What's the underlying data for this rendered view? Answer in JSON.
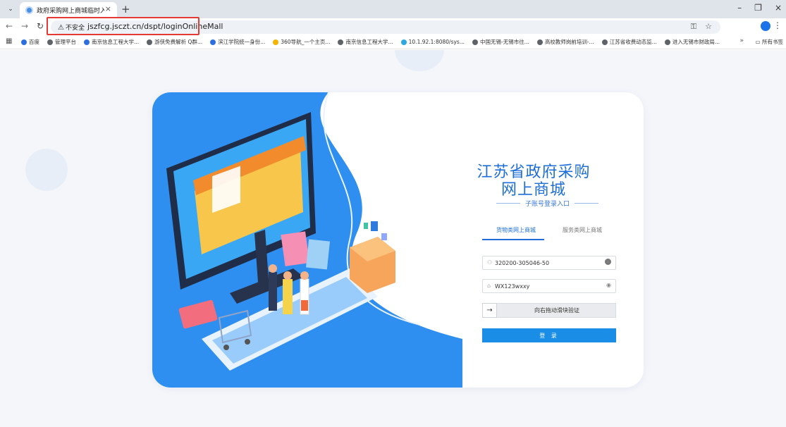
{
  "browser": {
    "tab_title": "政府采购网上商城临时入口",
    "security_label": "不安全",
    "url": "jszfcg.jsczt.cn/dspt/loginOnlineMall",
    "bookmarks": [
      {
        "label": "百度",
        "icon": "paw-icon",
        "color": "blue"
      },
      {
        "label": "管理平台",
        "icon": "globe-icon",
        "color": "dark"
      },
      {
        "label": "南京信息工程大学...",
        "icon": "paw-icon",
        "color": "blue"
      },
      {
        "label": "游侠免费解析 Q群...",
        "icon": "globe-icon",
        "color": "dark"
      },
      {
        "label": "滨江学院统一身份...",
        "icon": "shield-icon",
        "color": "blue"
      },
      {
        "label": "360导航_一个主页...",
        "icon": "nav-icon",
        "color": "yellow"
      },
      {
        "label": "南京信息工程大学...",
        "icon": "globe-icon",
        "color": "dark"
      },
      {
        "label": "10.1.92.1:8080/sys...",
        "icon": "globe-icon",
        "color": "cyan"
      },
      {
        "label": "中国无锡-无锡市往...",
        "icon": "globe-icon",
        "color": "dark"
      },
      {
        "label": "高校教师岗前培训-...",
        "icon": "globe-icon",
        "color": "dark"
      },
      {
        "label": "江苏省收费动态监...",
        "icon": "globe-icon",
        "color": "dark"
      },
      {
        "label": "进入无锡市财政局...",
        "icon": "globe-icon",
        "color": "dark"
      }
    ],
    "more_label": "»",
    "all_bookmarks_label": "所有书签"
  },
  "login": {
    "title_line1": "江苏省政府采购",
    "title_line2": "网上商城",
    "subtitle": "子账号登录入口",
    "tabs": [
      "货物类网上商城",
      "服务类网上商城"
    ],
    "username_value": "320200-305046-50",
    "password_value": "WX123wxxy",
    "slider_text": "向右拖动滑块验证",
    "login_button": "登 录"
  },
  "colors": {
    "accent": "#1d6ed8",
    "button": "#1a8ee6",
    "highlight_box": "#e53935",
    "illustration_blue": "#2f8ff0"
  }
}
